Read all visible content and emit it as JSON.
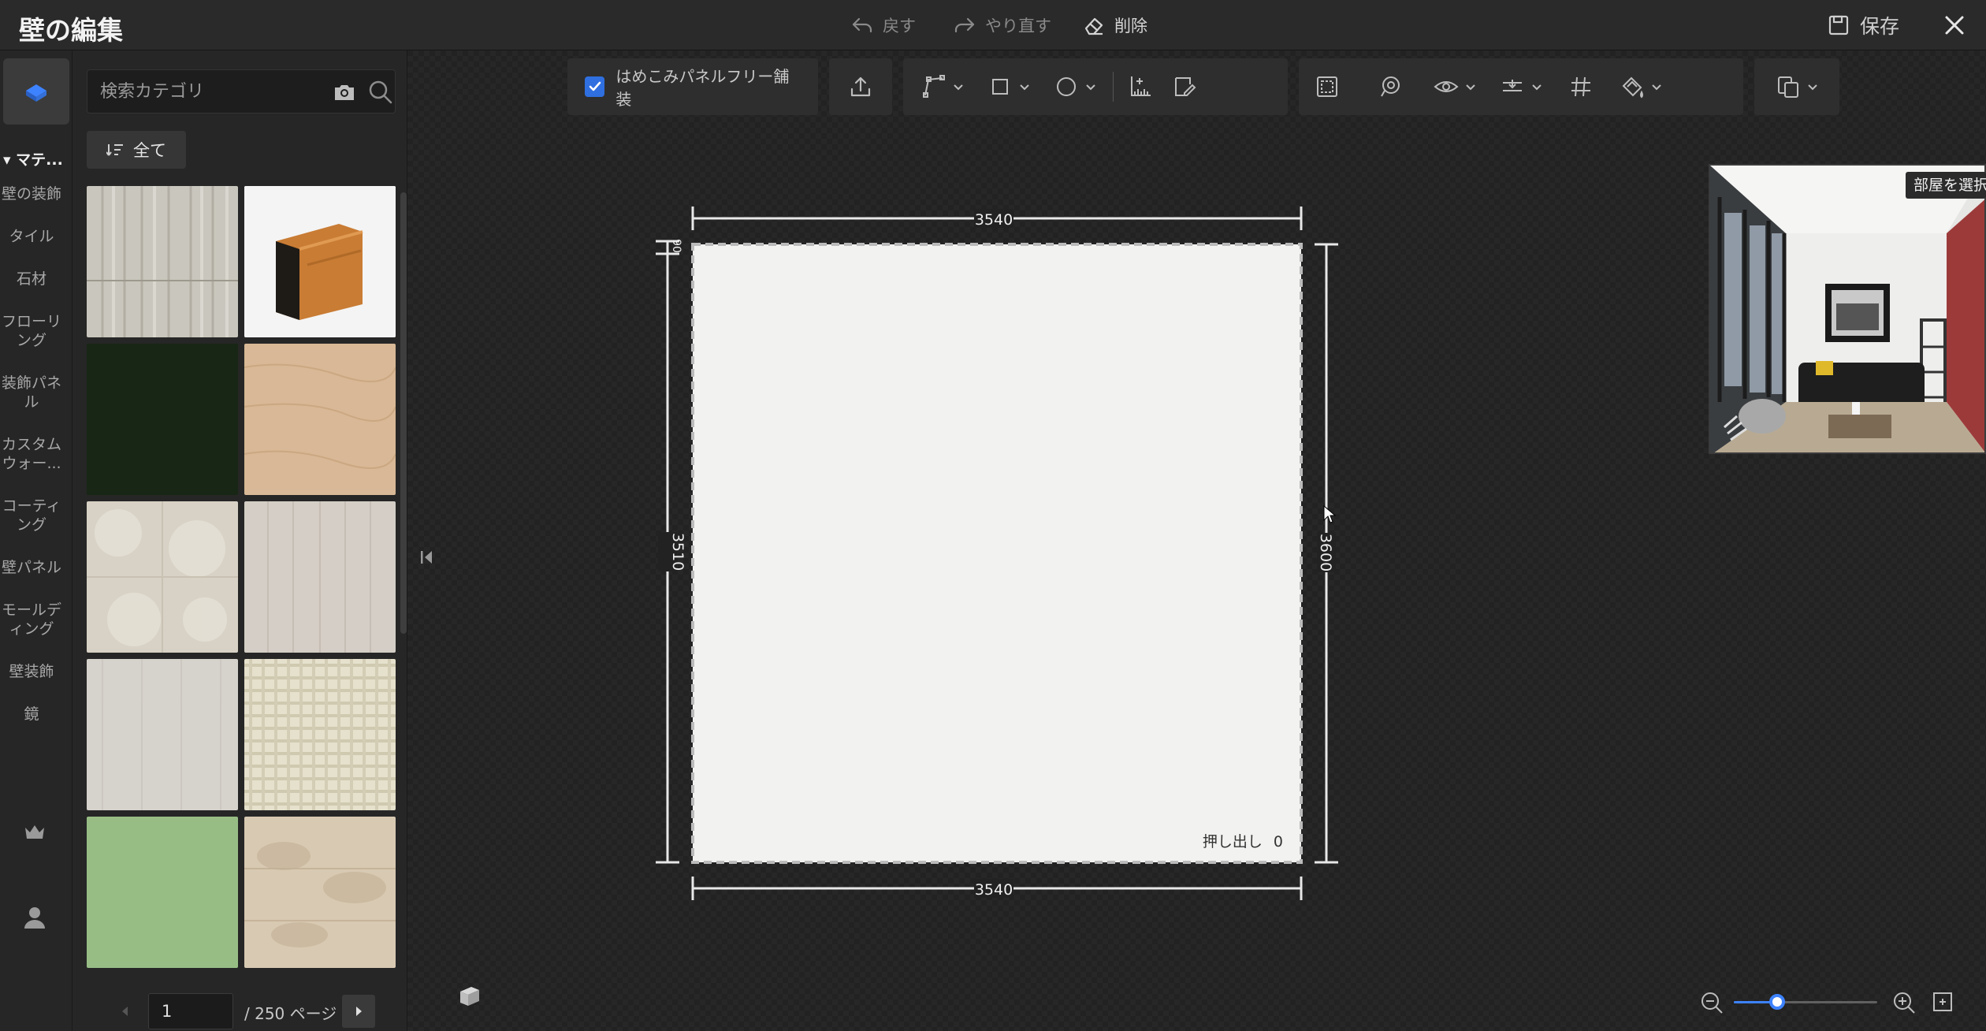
{
  "window": {
    "title": "壁の編集",
    "undo_label": "戻す",
    "redo_label": "やり直す",
    "delete_label": "削除",
    "save_label": "保存"
  },
  "rail": {
    "heading": "マテ...",
    "items": [
      {
        "label": "壁の装飾"
      },
      {
        "label": "タイル"
      },
      {
        "label": "石材"
      },
      {
        "label": "フローリング"
      },
      {
        "label": "装飾パネル"
      },
      {
        "label": "カスタムウォー..."
      },
      {
        "label": "コーティング"
      },
      {
        "label": "壁パネル"
      },
      {
        "label": "モールディング"
      },
      {
        "label": "壁装飾"
      },
      {
        "label": "鏡"
      }
    ],
    "icons": [
      "material-icon",
      "crown-icon",
      "user-icon"
    ]
  },
  "panel": {
    "search_placeholder": "検索カテゴリ",
    "filter_label": "全て",
    "materials": [
      {
        "name": "gray-wood",
        "color": "#c9c6bd"
      },
      {
        "name": "wood-baseboard",
        "color": "#c97c34"
      },
      {
        "name": "dark-green",
        "color": "#182616"
      },
      {
        "name": "light-oak",
        "color": "#d8b896"
      },
      {
        "name": "beige-marble",
        "color": "#d8d2c6"
      },
      {
        "name": "light-gray-wood",
        "color": "#d4cec6"
      },
      {
        "name": "pale-gray-plaster",
        "color": "#d6d2cc"
      },
      {
        "name": "cream-plaid",
        "color": "#e0dbc4"
      },
      {
        "name": "sage-green",
        "color": "#97bd84"
      },
      {
        "name": "tan-stone",
        "color": "#d8c9b2"
      }
    ],
    "pager": {
      "current": "1",
      "total_label": "/ 250 ページ"
    }
  },
  "toolbar": {
    "seamless_panel_label": "はめこみパネルフリー舗装",
    "seamless_panel_checked": true,
    "icons": [
      "upload-icon",
      "pen-icon",
      "rectangle-icon",
      "circle-icon",
      "ruler-icon",
      "edit-icon",
      "select-frame-icon",
      "lasso-icon",
      "eye-icon",
      "align-icon",
      "grid-icon",
      "fill-icon",
      "copy-icon"
    ]
  },
  "wall": {
    "width_top": "3540",
    "width_bottom": "3540",
    "height_left": "3510",
    "height_right": "3600",
    "offset_top_left": "90",
    "extrude_label": "押し出し",
    "extrude_value": "0"
  },
  "preview": {
    "room_select_label": "部屋を選択"
  },
  "zoom": {
    "level": 0.3
  },
  "colors": {
    "accent": "#2f6fe0",
    "canvas_bg": "#222222",
    "wall_fill": "#f2f2f0"
  }
}
